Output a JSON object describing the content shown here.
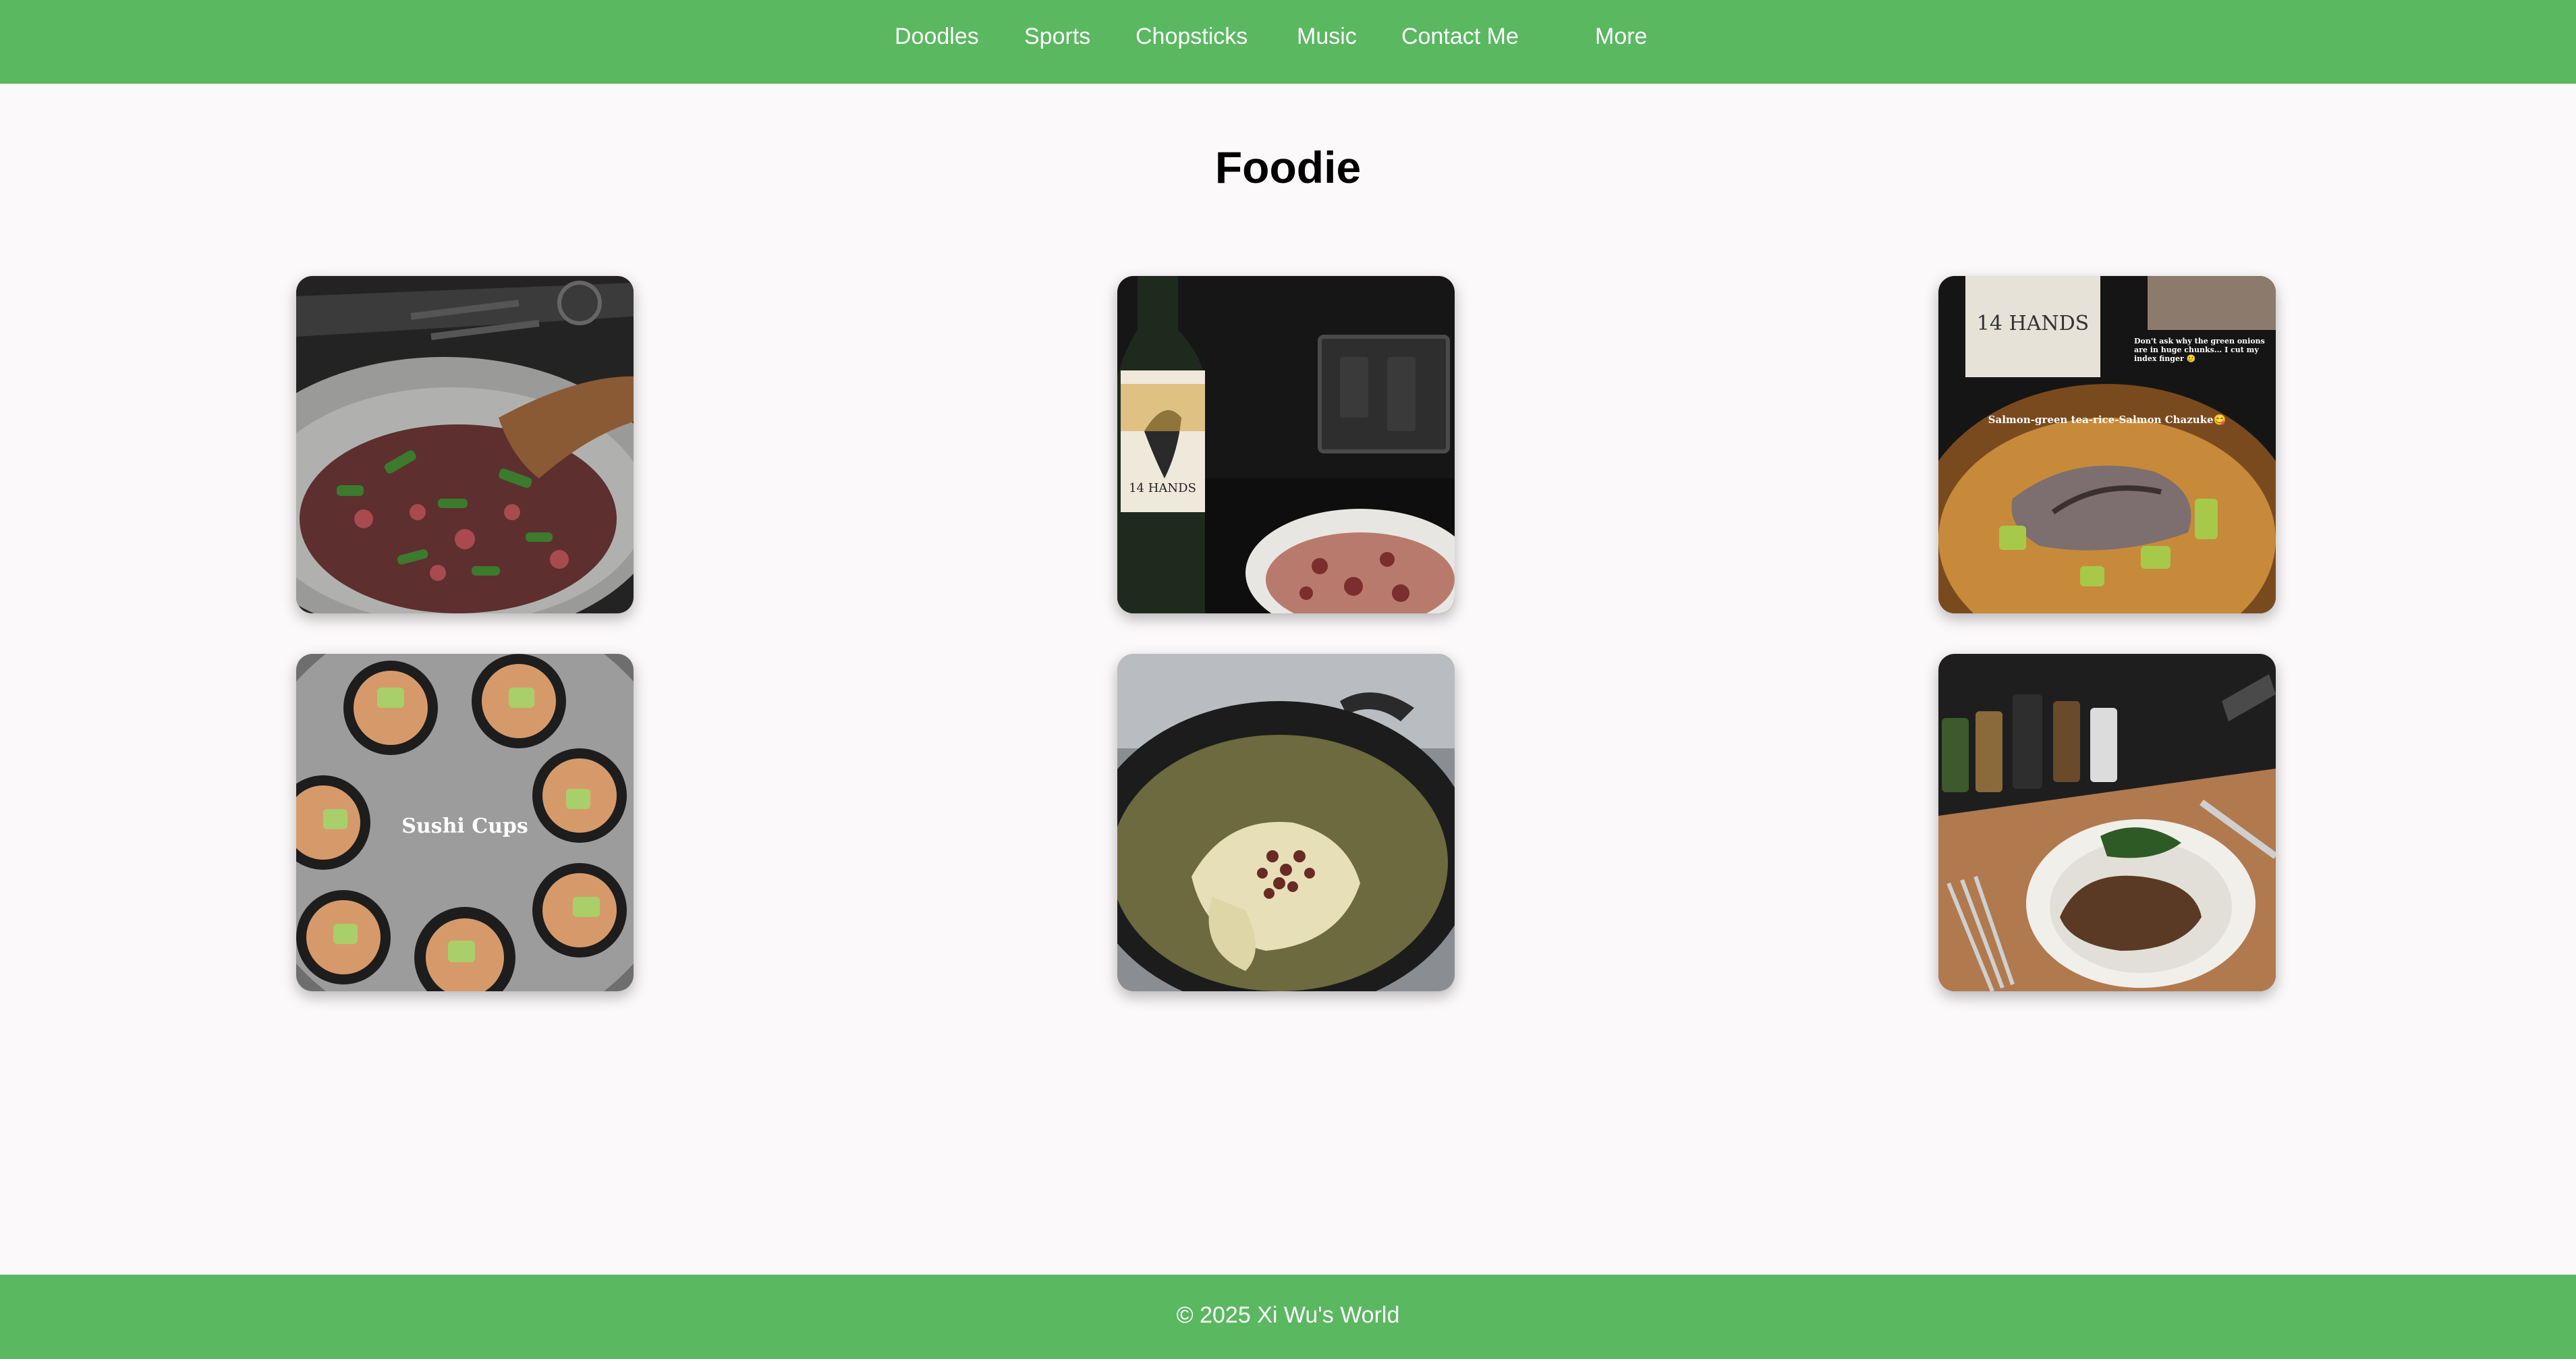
{
  "nav": {
    "items": [
      {
        "label": "Doodles"
      },
      {
        "label": "Sports"
      },
      {
        "label": "Chopsticks"
      },
      {
        "label": "Music"
      },
      {
        "label": "Contact Me"
      },
      {
        "label": "More"
      }
    ]
  },
  "page": {
    "title": "Foodie"
  },
  "gallery": {
    "photos": [
      {
        "subject": "beef-and-scallion-stir-fry",
        "caption": ""
      },
      {
        "subject": "wine-bottle-and-octopus-salad",
        "bottle_label": "14 HANDS",
        "caption": ""
      },
      {
        "subject": "salmon-chazuke",
        "caption": "Salmon-green tea-rice-Salmon Chazuke😋",
        "note": "Don't ask why the green onions are in huge chunks... I cut my index finger 🥲",
        "bottle_label": "14 HANDS"
      },
      {
        "subject": "sushi-cups",
        "caption": "Sushi Cups"
      },
      {
        "subject": "chicken-soup-in-dutch-oven",
        "caption": ""
      },
      {
        "subject": "steak-with-spinach",
        "caption": ""
      }
    ]
  },
  "footer": {
    "text": "© 2025 Xi Wu's World"
  },
  "colors": {
    "accent": "#5ab860",
    "background": "#fcf9fa",
    "title": "#000000"
  }
}
